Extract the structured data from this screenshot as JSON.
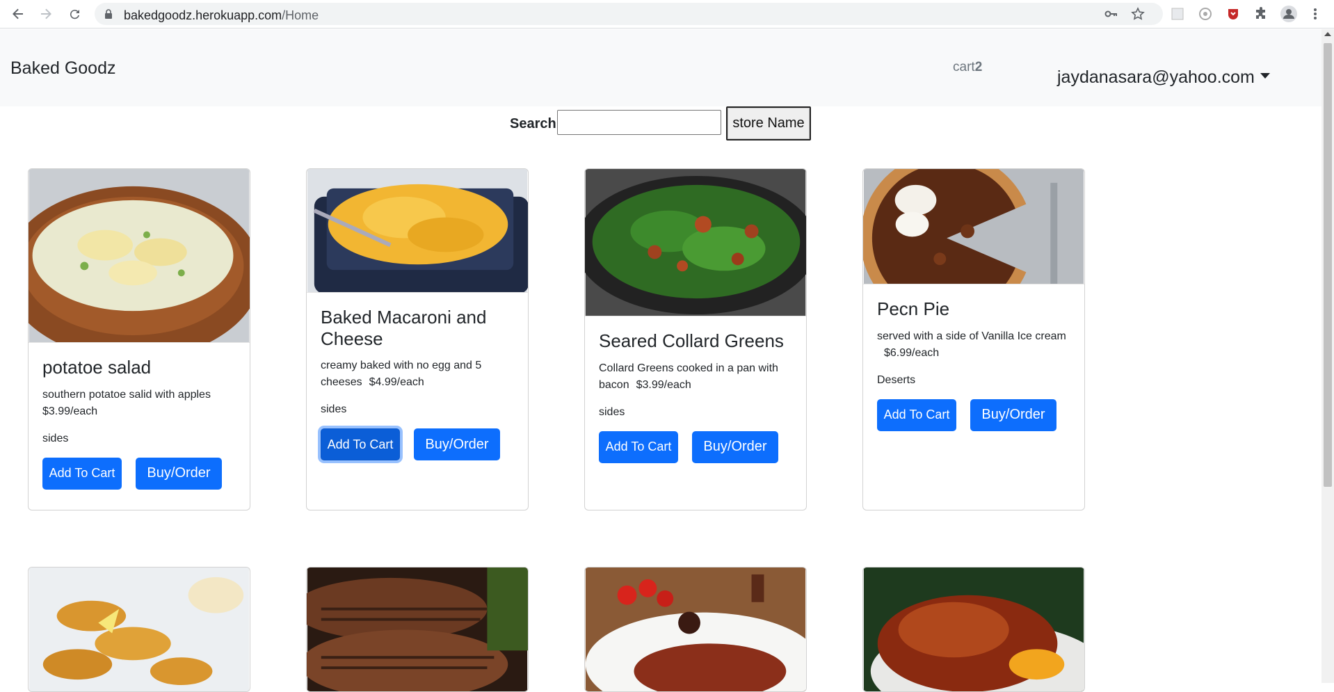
{
  "browser": {
    "url_host": "bakedgoodz.herokuapp.com",
    "url_path": "/Home"
  },
  "navbar": {
    "brand": "Baked Goodz",
    "cart_label": "cart",
    "cart_count": "2",
    "user_email": "jaydanasara@yahoo.com"
  },
  "search": {
    "label": "Search",
    "value": "",
    "button_label": "store Name"
  },
  "products": [
    {
      "name": "potatoe salad",
      "description": "southern potatoe salid with apples",
      "price": "$3.99/each",
      "category": "sides",
      "add_label": "Add To Cart",
      "buy_label": "Buy/Order"
    },
    {
      "name": "Baked Macaroni and Cheese",
      "description": "creamy baked with no egg and 5 cheeses",
      "price": "$4.99/each",
      "category": "sides",
      "add_label": "Add To Cart",
      "buy_label": "Buy/Order"
    },
    {
      "name": "Seared Collard Greens",
      "description": "Collard Greens cooked in a pan with bacon",
      "price": "$3.99/each",
      "category": "sides",
      "add_label": "Add To Cart",
      "buy_label": "Buy/Order"
    },
    {
      "name": "Pecn Pie",
      "description": "served with a side of Vanilla Ice cream",
      "price": "$6.99/each",
      "category": "Deserts",
      "add_label": "Add To Cart",
      "buy_label": "Buy/Order"
    }
  ],
  "colors": {
    "primary_button": "#0d6efd",
    "navbar_bg": "#f8f9fa"
  }
}
